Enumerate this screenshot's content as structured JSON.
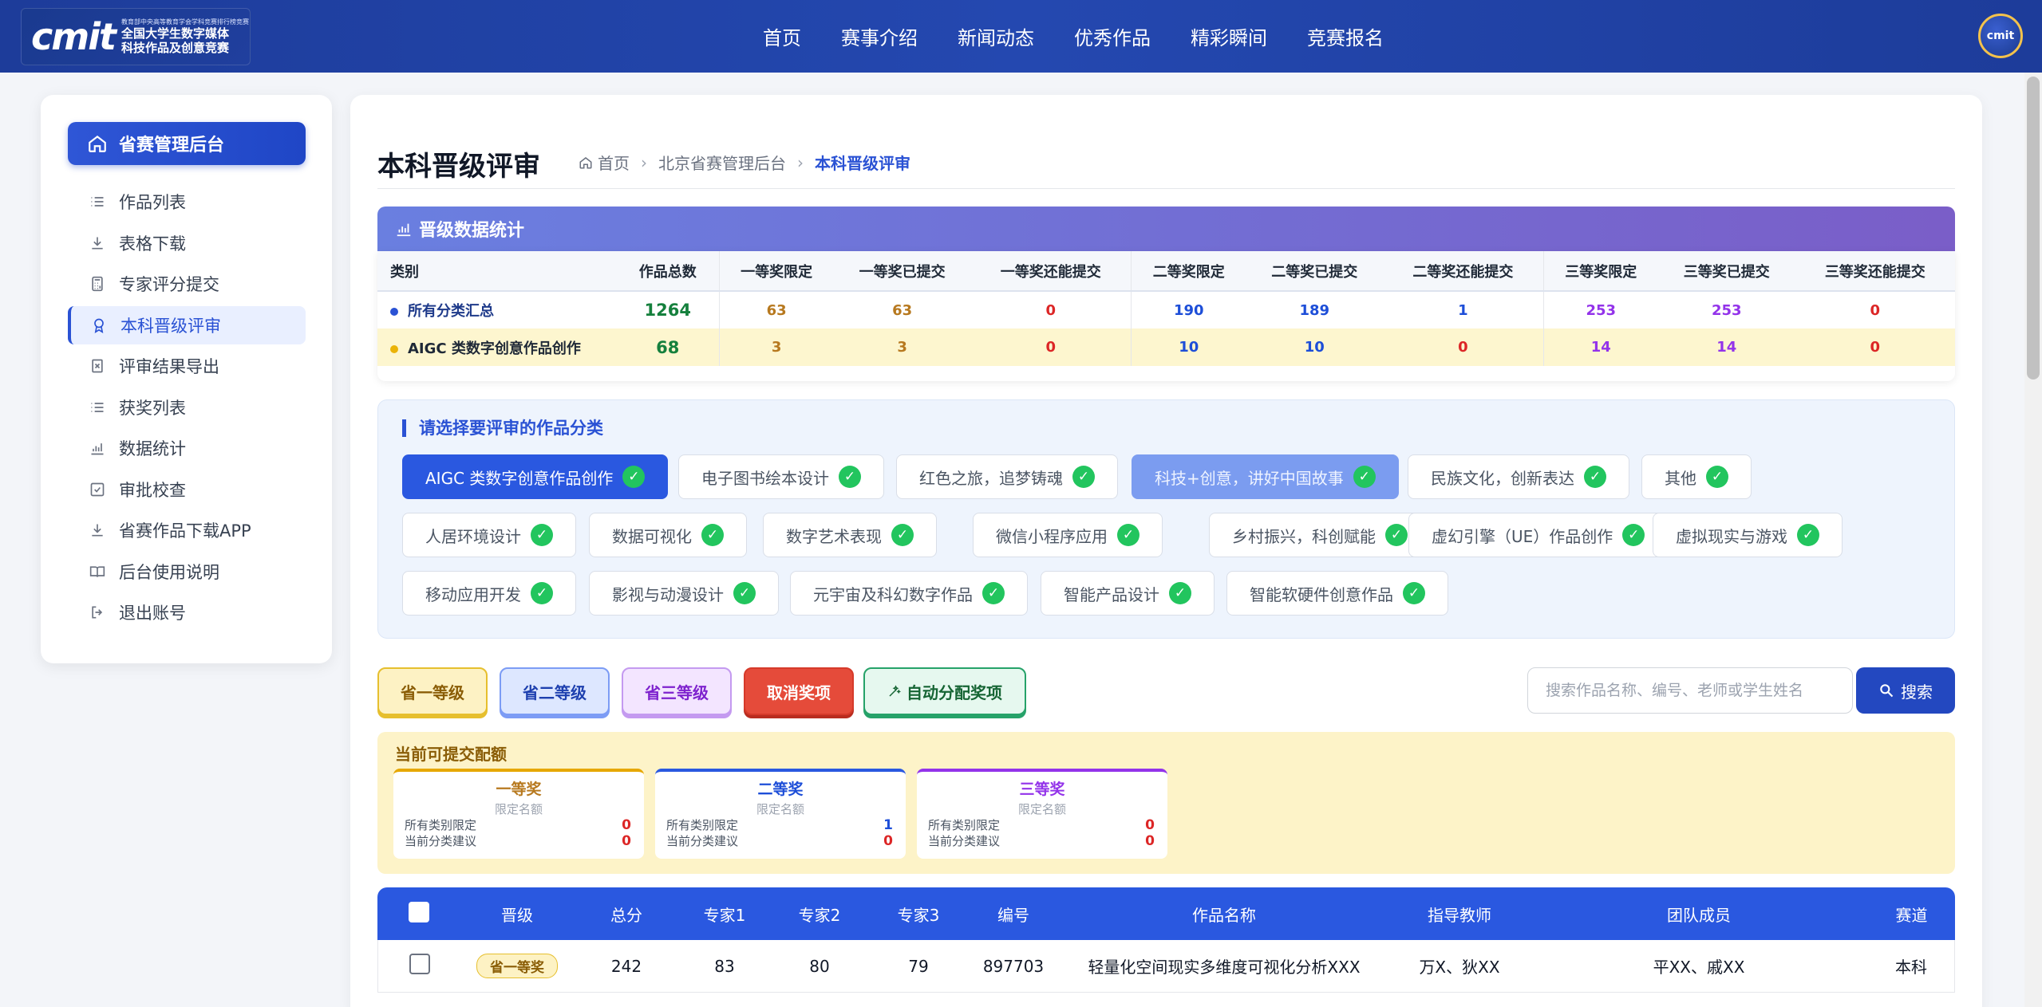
{
  "header": {
    "logo_mark": "cmit",
    "logo_title_1": "全国大学生数字媒体",
    "logo_title_2": "科技作品及创意竞赛",
    "logo_sub": "教育部中央高等教育学会学科竞赛排行榜竞赛",
    "nav": [
      "首页",
      "赛事介绍",
      "新闻动态",
      "优秀作品",
      "精彩瞬间",
      "竞赛报名"
    ],
    "avatar_text": "cmit"
  },
  "sidebar": {
    "title": "省赛管理后台",
    "items": [
      {
        "label": "作品列表",
        "icon": "list-icon"
      },
      {
        "label": "表格下载",
        "icon": "download-icon"
      },
      {
        "label": "专家评分提交",
        "icon": "calculator-icon"
      },
      {
        "label": "本科晋级评审",
        "icon": "award-icon",
        "active": true
      },
      {
        "label": "评审结果导出",
        "icon": "export-file-icon"
      },
      {
        "label": "获奖列表",
        "icon": "list-icon"
      },
      {
        "label": "数据统计",
        "icon": "bar-chart-icon"
      },
      {
        "label": "审批校查",
        "icon": "checkbox-icon"
      },
      {
        "label": "省赛作品下载APP",
        "icon": "download-icon"
      },
      {
        "label": "后台使用说明",
        "icon": "book-icon"
      },
      {
        "label": "退出账号",
        "icon": "logout-icon"
      }
    ]
  },
  "main": {
    "title": "本科晋级评审",
    "breadcrumb": [
      "首页",
      "北京省赛管理后台",
      "本科晋级评审"
    ],
    "stats_title": "晋级数据统计",
    "stats_headers": [
      "类别",
      "作品总数",
      "一等奖限定",
      "一等奖已提交",
      "一等奖还能提交",
      "二等奖限定",
      "二等奖已提交",
      "二等奖还能提交",
      "三等奖限定",
      "三等奖已提交",
      "三等奖还能提交"
    ],
    "stats_rows": [
      {
        "name": "所有分类汇总",
        "total": "1264",
        "values": [
          "63",
          "63",
          "0",
          "190",
          "189",
          "1",
          "253",
          "253",
          "0"
        ],
        "dot_color": "#2a52d4"
      },
      {
        "name": "AIGC 类数字创意作品创作",
        "total": "68",
        "values": [
          "3",
          "3",
          "0",
          "10",
          "10",
          "0",
          "14",
          "14",
          "0"
        ],
        "dot_color": "#eab308"
      }
    ],
    "category_title": "请选择要评审的作品分类",
    "categories": [
      "AIGC 类数字创意作品创作",
      "电子图书绘本设计",
      "红色之旅，追梦铸魂",
      "科技+创意，讲好中国故事",
      "民族文化，创新表达",
      "其他",
      "人居环境设计",
      "数据可视化",
      "数字艺术表现",
      "微信小程序应用",
      "乡村振兴，科创赋能",
      "虚幻引擎（UE）作品创作",
      "虚拟现实与游戏",
      "移动应用开发",
      "影视与动漫设计",
      "元宇宙及科幻数字作品",
      "智能产品设计",
      "智能软硬件创意作品"
    ],
    "check_mark": "✓",
    "actions": {
      "first": "省一等级",
      "second": "省二等级",
      "third": "省三等级",
      "cancel": "取消奖项",
      "auto": "自动分配奖项"
    },
    "search": {
      "placeholder": "搜索作品名称、编号、老师或学生姓名",
      "button": "搜索"
    },
    "quota": {
      "title": "当前可提交配额",
      "cards": [
        {
          "title": "一等奖",
          "sub": "限定名额",
          "label1": "所有类别限定",
          "val1": "0",
          "label2": "当前分类建议",
          "val2": "0",
          "color": "#b7791f"
        },
        {
          "title": "二等奖",
          "sub": "限定名额",
          "label1": "所有类别限定",
          "val1": "1",
          "label2": "当前分类建议",
          "val2": "0",
          "color": "#1d4ed8"
        },
        {
          "title": "三等奖",
          "sub": "限定名额",
          "label1": "所有类别限定",
          "val1": "0",
          "label2": "当前分类建议",
          "val2": "0",
          "color": "#9333ea"
        }
      ]
    },
    "table": {
      "headers": [
        "晋级",
        "总分",
        "专家1",
        "专家2",
        "专家3",
        "编号",
        "作品名称",
        "指导教师",
        "团队成员",
        "赛道"
      ],
      "rows": [
        {
          "level": "省一等奖",
          "total": "242",
          "e1": "83",
          "e2": "80",
          "e3": "79",
          "id": "897703",
          "name": "轻量化空间现实多维度可视化分析XXX",
          "teacher": "万X、狄XX",
          "team": "平XX、戚XX",
          "track": "本科"
        }
      ]
    }
  },
  "colors": {
    "brand": "#1d3c9a",
    "accent": "#2a58e0",
    "success": "#22c55e",
    "danger": "#e54b3a"
  }
}
